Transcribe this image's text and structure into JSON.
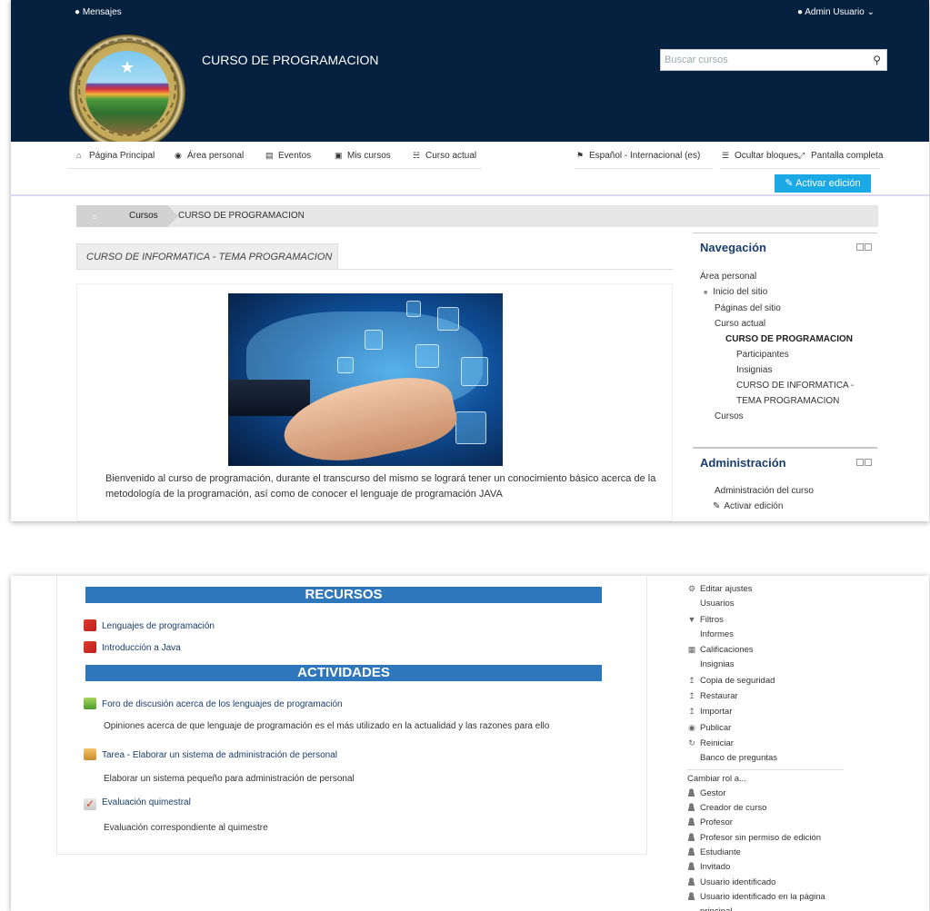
{
  "topbar": {
    "messages": "Mensajes",
    "user": "Admin Usuario",
    "chevron": "chevron-down-icon"
  },
  "header": {
    "site_title": "CURSO DE PROGRAMACION",
    "search_placeholder": "Buscar cursos"
  },
  "nav": {
    "items": [
      "Página Principal",
      "Área personal",
      "Eventos",
      "Mis cursos",
      "Curso actual"
    ],
    "language": "Español - Internacional (es)",
    "hide_blocks": "Ocultar bloques",
    "fullscreen": "Pantalla completa",
    "edit_button": "Activar edición"
  },
  "breadcrumb": {
    "cursos": "Cursos",
    "current": "CURSO DE PROGRAMACION"
  },
  "section": {
    "title": "CURSO DE INFORMATICA - TEMA PROGRAMACION",
    "intro": "Bienvenido al curso de programación, durante el transcurso del mismo se logrará tener un conocimiento básico acerca de la metodología de la programación, así como de conocer el lenguaje de programación JAVA"
  },
  "navigation_block": {
    "title": "Navegación",
    "items": [
      "Área personal",
      "Inicio del sitio",
      "Páginas del sitio",
      "Curso actual",
      "CURSO DE PROGRAMACION",
      "Participantes",
      "Insignias",
      "CURSO DE INFORMATICA -",
      "TEMA PROGRAMACION",
      "Cursos"
    ]
  },
  "admin_block": {
    "title": "Administración",
    "course_admin": "Administración del curso",
    "activate_edit": "Activar edición"
  },
  "resources": {
    "header": "RECURSOS",
    "items": [
      "Lenguajes de programación",
      "Introducción a Java"
    ]
  },
  "activities": {
    "header": "ACTIVIDADES",
    "forum": "Foro de discusión acerca de los lenguajes de programación",
    "forum_desc": "Opiniones acerca de que lenguaje de programación es el más utilizado en la actualidad y las razones para ello",
    "task": "Tarea - Elaborar un sistema de administración de personal",
    "task_desc": "Elaborar un sistema pequeño para administración de personal",
    "quiz": "Evaluación quimestral",
    "quiz_desc": "Evaluación correspondiente al quimestre"
  },
  "admin_menu": {
    "items": [
      "Editar ajustes",
      "Usuarios",
      "Filtros",
      "Informes",
      "Calificaciones",
      "Insignias",
      "Copia de seguridad",
      "Restaurar",
      "Importar",
      "Publicar",
      "Reiniciar",
      "Banco de preguntas"
    ],
    "switch_role": "Cambiar rol a...",
    "roles": [
      "Gestor",
      "Creador de curso",
      "Profesor",
      "Profesor sin permiso de edición",
      "Estudiante",
      "Invitado",
      "Usuario identificado",
      "Usuario identificado en la página",
      "principal"
    ]
  },
  "colors": {
    "header_bg": "#06203f",
    "accent": "#1ba9e6",
    "section_bar": "#2e77bd",
    "link": "#1a3d6b"
  }
}
